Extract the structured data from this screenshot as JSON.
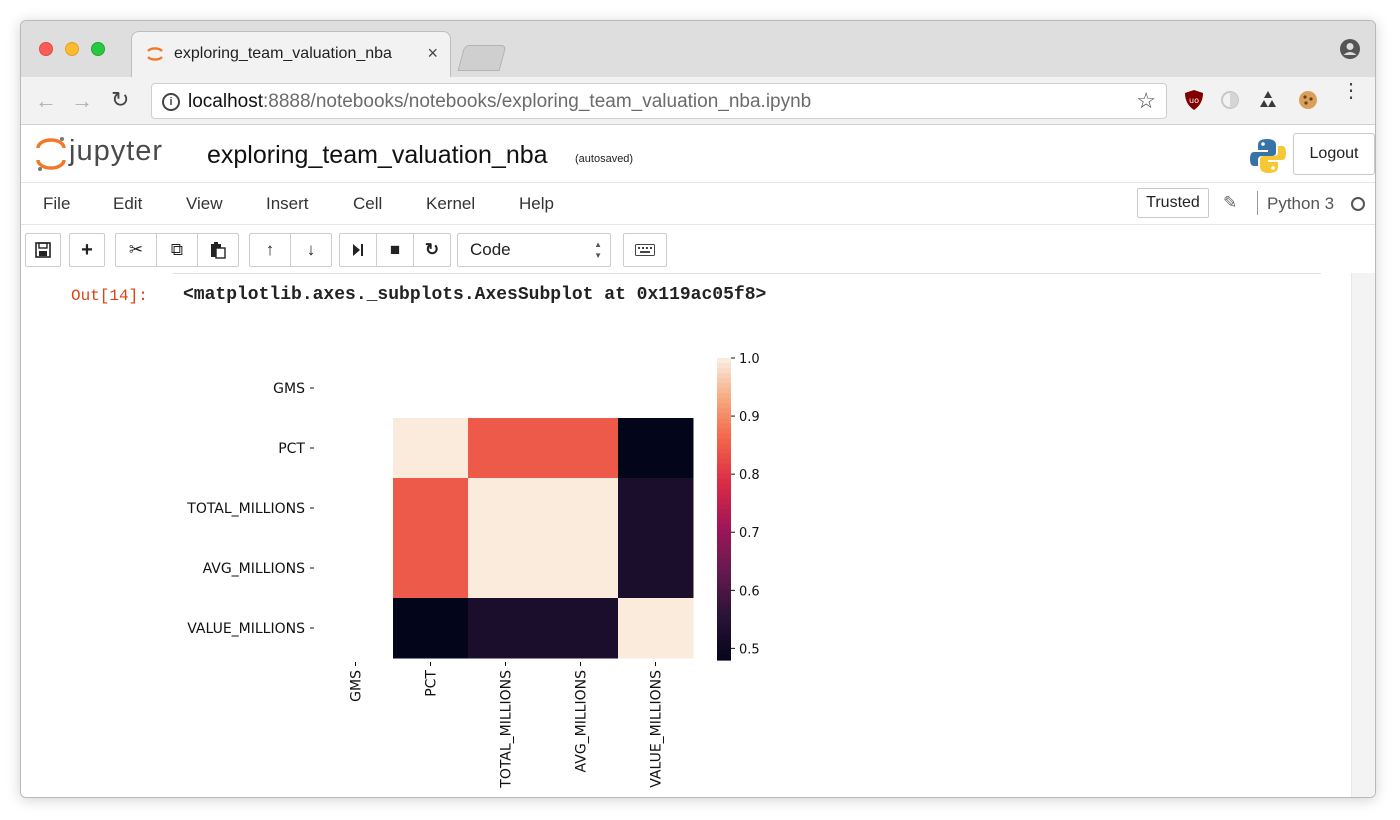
{
  "browser": {
    "tab_title": "exploring_team_valuation_nba",
    "tab_close": "×",
    "url_host": "localhost",
    "url_path": ":8888/notebooks/notebooks/exploring_team_valuation_nba.ipynb",
    "nav_back": "←",
    "nav_forward": "→",
    "reload": "↻",
    "star": "☆",
    "menu": "⋮"
  },
  "jupyter": {
    "logo_text": "jupyter",
    "notebook_title": "exploring_team_valuation_nba",
    "autosave_status": "(autosaved)",
    "logout_label": "Logout",
    "menus": [
      "File",
      "Edit",
      "View",
      "Insert",
      "Cell",
      "Kernel",
      "Help"
    ],
    "trusted_label": "Trusted",
    "kernel_name": "Python 3",
    "cell_type": "Code",
    "accent_color": "#f37726"
  },
  "toolbar": {
    "save": "💾",
    "add": "+",
    "cut": "✂",
    "copy": "⧉",
    "paste": "📋",
    "up": "↑",
    "down": "↓",
    "run": "⏭",
    "stop": "■",
    "restart": "↻",
    "keyboard": "⌨"
  },
  "output": {
    "prompt": "Out[14]:",
    "text": "<matplotlib.axes._subplots.AxesSubplot at 0x119ac05f8>"
  },
  "chart_data": {
    "type": "heatmap",
    "title": "",
    "xlabel": "",
    "ylabel": "",
    "rows": [
      "GMS",
      "PCT",
      "TOTAL_MILLIONS",
      "AVG_MILLIONS",
      "VALUE_MILLIONS"
    ],
    "cols": [
      "GMS",
      "PCT",
      "TOTAL_MILLIONS",
      "AVG_MILLIONS",
      "VALUE_MILLIONS"
    ],
    "values": [
      [
        null,
        null,
        null,
        null,
        null
      ],
      [
        null,
        1.0,
        0.85,
        0.85,
        0.48
      ],
      [
        null,
        0.85,
        1.0,
        1.0,
        0.53
      ],
      [
        null,
        0.85,
        1.0,
        1.0,
        0.53
      ],
      [
        null,
        0.48,
        0.53,
        0.53,
        1.0
      ]
    ],
    "colorbar": {
      "min": 0.48,
      "max": 1.0,
      "ticks": [
        "1.0",
        "0.9",
        "0.8",
        "0.7",
        "0.6",
        "0.5"
      ],
      "tick_values": [
        1.0,
        0.9,
        0.8,
        0.7,
        0.6,
        0.5
      ],
      "colormap": "rocket"
    }
  }
}
